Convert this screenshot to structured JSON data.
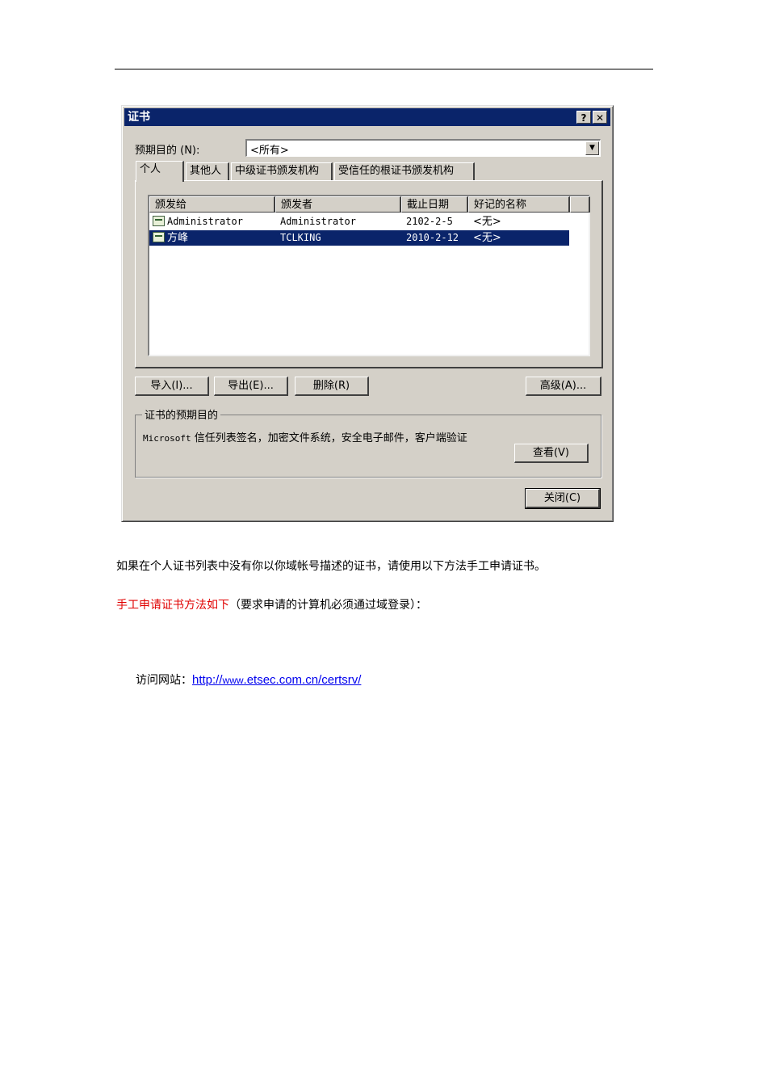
{
  "dialog": {
    "title": "证书",
    "help_btn": "?",
    "close_btn": "✕",
    "purpose_label": "预期目的 (N):",
    "purpose_value": "<所有>",
    "tabs": [
      "个人",
      "其他人",
      "中级证书颁发机构",
      "受信任的根证书颁发机构"
    ],
    "columns": [
      "颁发给",
      "颁发者",
      "截止日期",
      "好记的名称"
    ],
    "rows": [
      {
        "issued_to": "Administrator",
        "issued_by": "Administrator",
        "expires": "2102-2-5",
        "friendly": "<无>",
        "selected": false
      },
      {
        "issued_to": "方峰",
        "issued_by": "TCLKING",
        "expires": "2010-2-12",
        "friendly": "<无>",
        "selected": true
      }
    ],
    "buttons": {
      "import": "导入(I)...",
      "export": "导出(E)...",
      "delete": "删除(R)",
      "advanced": "高级(A)...",
      "view": "查看(V)",
      "close": "关闭(C)"
    },
    "purposes_group": "证书的预期目的",
    "purposes_en": "Microsoft",
    "purposes_cn": " 信任列表签名，加密文件系统，安全电子邮件，客户端验证"
  },
  "text": {
    "para1": "如果在个人证书列表中没有你以你域帐号描述的证书，请使用以下方法手工申请证书。",
    "para2_red": "手工申请证书方法如下",
    "para2_rest": "（要求申请的计算机必须通过域登录）：",
    "visit_label": "访问网站：",
    "url_a": "http://",
    "url_b": "www",
    "url_c": ".etsec.com.cn/certsrv/"
  }
}
